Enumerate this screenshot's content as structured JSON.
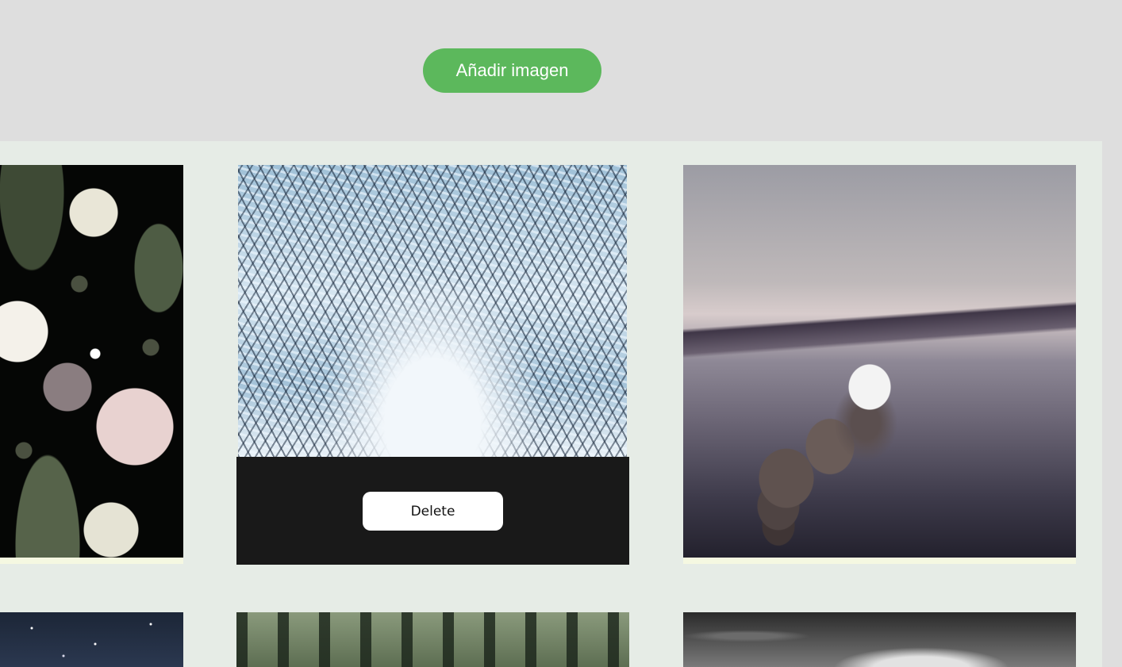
{
  "header": {
    "add_image_label": "Añadir imagen"
  },
  "colors": {
    "add_button": "#5cb85c",
    "gallery_background": "#e6ece6",
    "delete_panel": "#191919"
  },
  "gallery": {
    "items": [
      {
        "image": "dark-floral-roses-image"
      },
      {
        "image": "snowy-forest-path-image",
        "hovered": true,
        "delete_label": "Delete"
      },
      {
        "image": "misty-lake-stepping-stones-image"
      },
      {
        "image": "starry-night-sky-image"
      },
      {
        "image": "foggy-forest-image"
      },
      {
        "image": "stormy-clouds-image"
      }
    ]
  }
}
